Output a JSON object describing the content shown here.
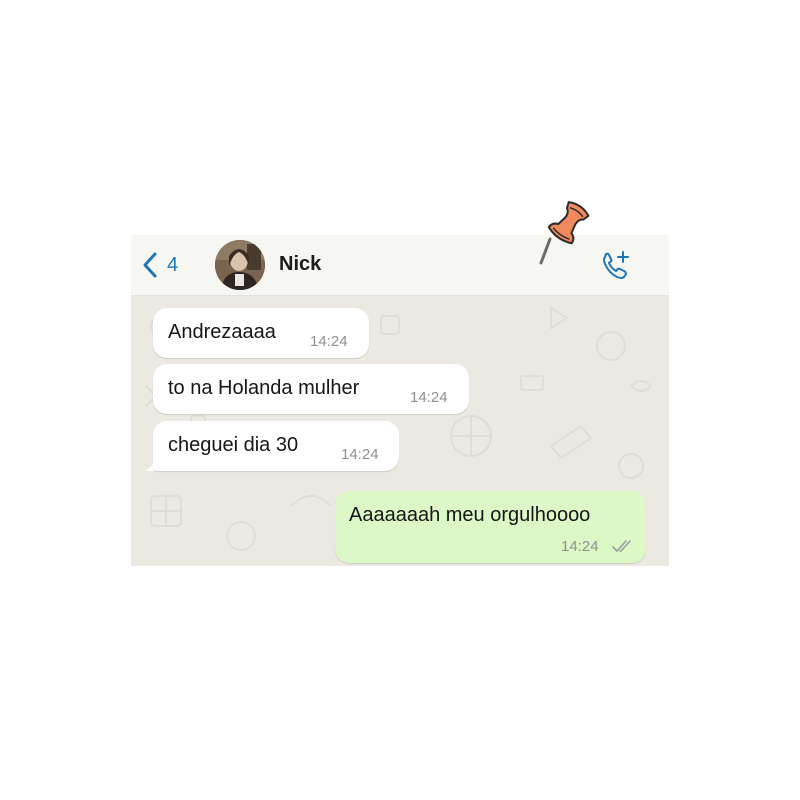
{
  "header": {
    "back_count": "4",
    "contact_name": "Nick"
  },
  "messages": [
    {
      "direction": "incoming",
      "text": "Andrezaaaa",
      "time": "14:24"
    },
    {
      "direction": "incoming",
      "text": "to na Holanda mulher",
      "time": "14:24"
    },
    {
      "direction": "incoming",
      "text": "cheguei dia 30",
      "time": "14:24"
    },
    {
      "direction": "outgoing",
      "text": "Aaaaaaah meu orgulhoooo",
      "time": "14:24",
      "status": "read-double-check"
    }
  ],
  "icons": {
    "back": "chevron-left-icon",
    "add_call": "phone-plus-icon",
    "read_receipt": "double-check-icon",
    "sticker": "pushpin-icon"
  },
  "colors": {
    "accent": "#1d76b8",
    "outgoing_bubble": "#dcf8c6",
    "incoming_bubble": "#ffffff",
    "chat_background": "#ece9e2",
    "header_background": "#f6f7f3",
    "pushpin": "#f08a5d"
  }
}
